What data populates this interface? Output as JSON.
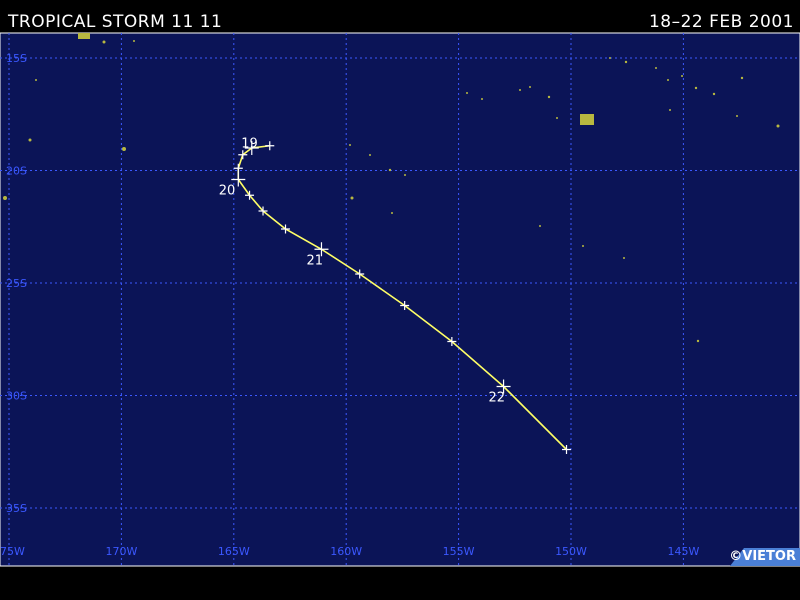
{
  "header": {
    "title": "TROPICAL STORM 11 11",
    "dates": "18–22 FEB 2001"
  },
  "map": {
    "ocean_color": "#0b1457",
    "grid_color": "#3b58ff",
    "land_color": "#b8b840",
    "track_color": "#ffff66",
    "lat_labels": [
      "15S",
      "20S",
      "25S",
      "30S",
      "35S"
    ],
    "lon_labels": [
      "175W",
      "170W",
      "165W",
      "160W",
      "155W",
      "150W",
      "145W"
    ]
  },
  "track": {
    "points": [
      {
        "lon": -163.4,
        "lat": -18.9
      },
      {
        "lon": -164.2,
        "lat": -19.0
      },
      {
        "lon": -164.6,
        "lat": -19.3
      },
      {
        "lon": -164.8,
        "lat": -19.9
      },
      {
        "lon": -164.8,
        "lat": -20.4
      },
      {
        "lon": -164.3,
        "lat": -21.1
      },
      {
        "lon": -163.7,
        "lat": -21.8
      },
      {
        "lon": -162.7,
        "lat": -22.6
      },
      {
        "lon": -161.1,
        "lat": -23.5
      },
      {
        "lon": -159.4,
        "lat": -24.6
      },
      {
        "lon": -157.4,
        "lat": -26.0
      },
      {
        "lon": -155.3,
        "lat": -27.6
      },
      {
        "lon": -153.0,
        "lat": -29.6
      },
      {
        "lon": -150.2,
        "lat": -32.4
      }
    ],
    "day_labels": [
      {
        "text": "19",
        "lon": -164.3,
        "lat": -18.7
      },
      {
        "text": "20",
        "lon": -165.3,
        "lat": -20.8
      },
      {
        "text": "21",
        "lon": -161.4,
        "lat": -23.9
      },
      {
        "text": "22",
        "lon": -153.3,
        "lat": -30.0
      }
    ]
  },
  "watermark": "©VIETOR"
}
